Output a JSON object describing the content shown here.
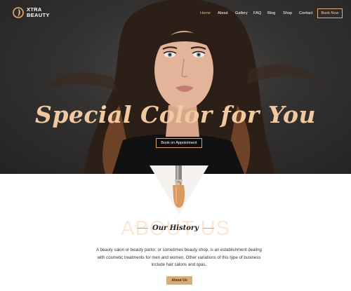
{
  "brand": {
    "line1": "XTRA",
    "line2": "BEAUTY"
  },
  "nav": {
    "items": [
      {
        "label": "Home",
        "active": true
      },
      {
        "label": "About",
        "active": false
      },
      {
        "label": "Gallery",
        "active": false
      },
      {
        "label": "FAQ",
        "active": false
      },
      {
        "label": "Blog",
        "active": false
      },
      {
        "label": "Shop",
        "active": false
      },
      {
        "label": "Contact",
        "active": false
      }
    ],
    "cta_label": "Book Now"
  },
  "hero": {
    "title": "Special Color for You",
    "button_label": "Book on Appointment"
  },
  "about": {
    "watermark": "ABOUT US",
    "heading": "Our History",
    "text": "A beauty salon or beauty parlor, or sometimes beauty shop, is an establishment dealing with cosmetic treatments for men and women. Other variations of this type of business include hair salons and spas.",
    "button_label": "About Us"
  },
  "colors": {
    "accent": "#e3ae77",
    "active_nav": "#e6b27a",
    "button_fill": "#d7ac76",
    "hero_bg": "#343231"
  },
  "icons": {
    "logo": "gold-circle-leaf-icon"
  }
}
